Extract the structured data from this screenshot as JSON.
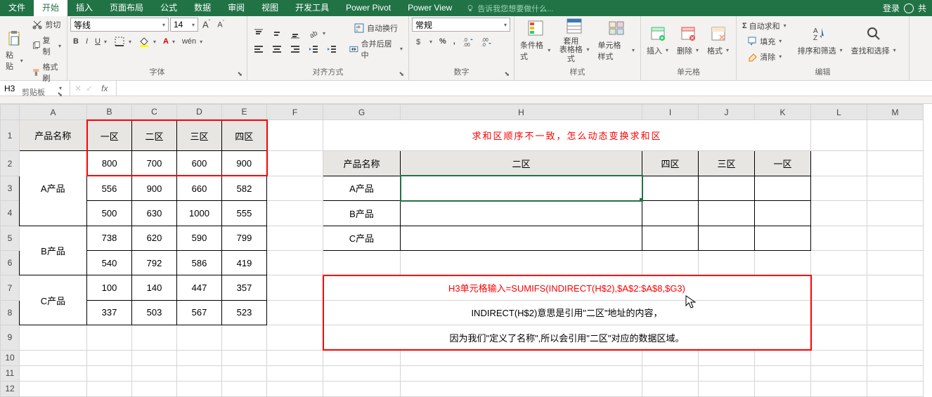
{
  "titlebar": {
    "tabs": [
      "文件",
      "开始",
      "插入",
      "页面布局",
      "公式",
      "数据",
      "审阅",
      "视图",
      "开发工具",
      "Power Pivot",
      "Power View"
    ],
    "active_index": 1,
    "tellme": "告诉我您想要做什么...",
    "login": "登录",
    "share": "共"
  },
  "ribbon": {
    "clipboard": {
      "paste": "粘贴",
      "cut": "剪切",
      "copy": "复制",
      "format_painter": "格式刷",
      "label": "剪贴板"
    },
    "font": {
      "name": "等线",
      "size": "14",
      "label": "字体"
    },
    "alignment": {
      "wrap": "自动换行",
      "merge": "合并后居中",
      "label": "对齐方式"
    },
    "number": {
      "format": "常规",
      "label": "数字"
    },
    "styles": {
      "conditional": "条件格式",
      "as_table": "套用\n表格格式",
      "cell_styles": "单元格样式",
      "label": "样式"
    },
    "cells": {
      "insert": "插入",
      "delete": "删除",
      "format": "格式",
      "label": "单元格"
    },
    "editing": {
      "autosum": "自动求和",
      "fill": "填充",
      "clear": "清除",
      "sort": "排序和筛选",
      "find": "查找和选择",
      "label": "编辑"
    }
  },
  "fbar": {
    "name": "H3",
    "formula": ""
  },
  "cols": [
    "A",
    "B",
    "C",
    "D",
    "E",
    "F",
    "G",
    "H",
    "I",
    "J",
    "K",
    "L",
    "M"
  ],
  "rows": [
    "1",
    "2",
    "3",
    "4",
    "5",
    "6",
    "7",
    "8",
    "9",
    "10",
    "11",
    "12"
  ],
  "left": {
    "header": [
      "产品名称",
      "一区",
      "二区",
      "三区",
      "四区"
    ],
    "products": [
      "A产品",
      "B产品",
      "C产品"
    ],
    "data": [
      [
        "800",
        "700",
        "600",
        "900"
      ],
      [
        "556",
        "900",
        "660",
        "582"
      ],
      [
        "500",
        "630",
        "1000",
        "555"
      ],
      [
        "738",
        "620",
        "590",
        "799"
      ],
      [
        "540",
        "792",
        "586",
        "419"
      ],
      [
        "100",
        "140",
        "447",
        "357"
      ],
      [
        "337",
        "503",
        "567",
        "523"
      ]
    ]
  },
  "right": {
    "title": "求和区顺序不一致，怎么动态变换求和区",
    "header": [
      "产品名称",
      "二区",
      "四区",
      "三区",
      "一区"
    ],
    "products": [
      "A产品",
      "B产品",
      "C产品"
    ],
    "notes": [
      "H3单元格输入=SUMIFS(INDIRECT(H$2),$A$2:$A$8,$G3)",
      "INDIRECT(H$2)意思是引用\"二区\"地址的内容，",
      "因为我们\"定义了名称\",所以会引用\"二区\"对应的数据区域。"
    ]
  },
  "chart_data": {
    "type": "table",
    "title": "产品各区数据",
    "columns": [
      "产品名称",
      "一区",
      "二区",
      "三区",
      "四区"
    ],
    "rows": [
      {
        "product": "A产品",
        "values": [
          [
            800,
            700,
            600,
            900
          ],
          [
            556,
            900,
            660,
            582
          ],
          [
            500,
            630,
            1000,
            555
          ]
        ]
      },
      {
        "product": "B产品",
        "values": [
          [
            738,
            620,
            590,
            799
          ],
          [
            540,
            792,
            586,
            419
          ]
        ]
      },
      {
        "product": "C产品",
        "values": [
          [
            100,
            140,
            447,
            357
          ],
          [
            337,
            503,
            567,
            523
          ]
        ]
      }
    ]
  }
}
